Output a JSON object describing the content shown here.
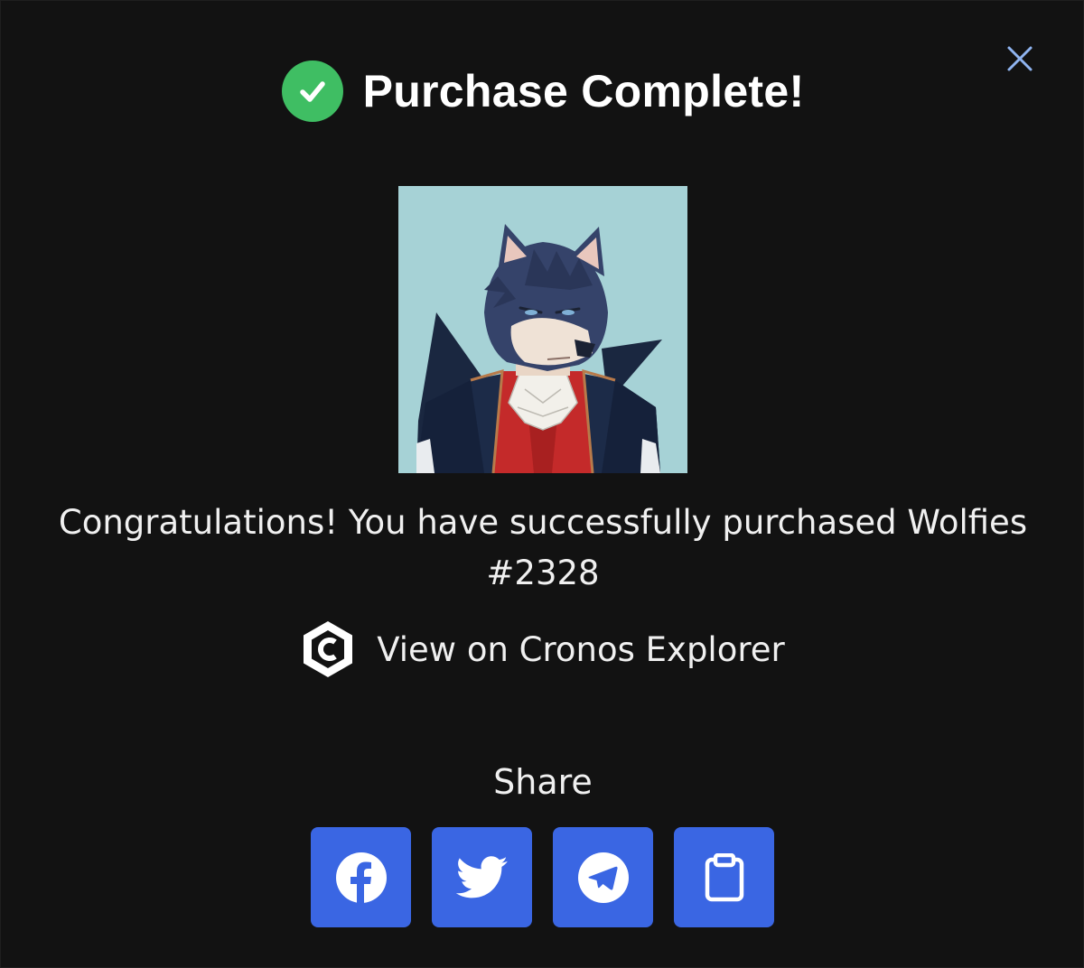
{
  "modal": {
    "title": "Purchase Complete!",
    "message": "Congratulations! You have successfully purchased Wolfies #2328",
    "explorer_link": "View on Cronos Explorer",
    "share_label": "Share",
    "close_icon": "close-icon",
    "status_icon": "check-circle-icon",
    "nft_image_description_icon": "wolf-nft-image"
  },
  "share_buttons": [
    {
      "name": "facebook",
      "icon": "facebook-icon"
    },
    {
      "name": "twitter",
      "icon": "twitter-icon"
    },
    {
      "name": "telegram",
      "icon": "telegram-icon"
    },
    {
      "name": "copy",
      "icon": "clipboard-icon"
    }
  ],
  "colors": {
    "background": "#121212",
    "success_green": "#3fbe63",
    "share_button_blue": "#3a66e3",
    "close_icon_color": "#8fb4f0"
  }
}
